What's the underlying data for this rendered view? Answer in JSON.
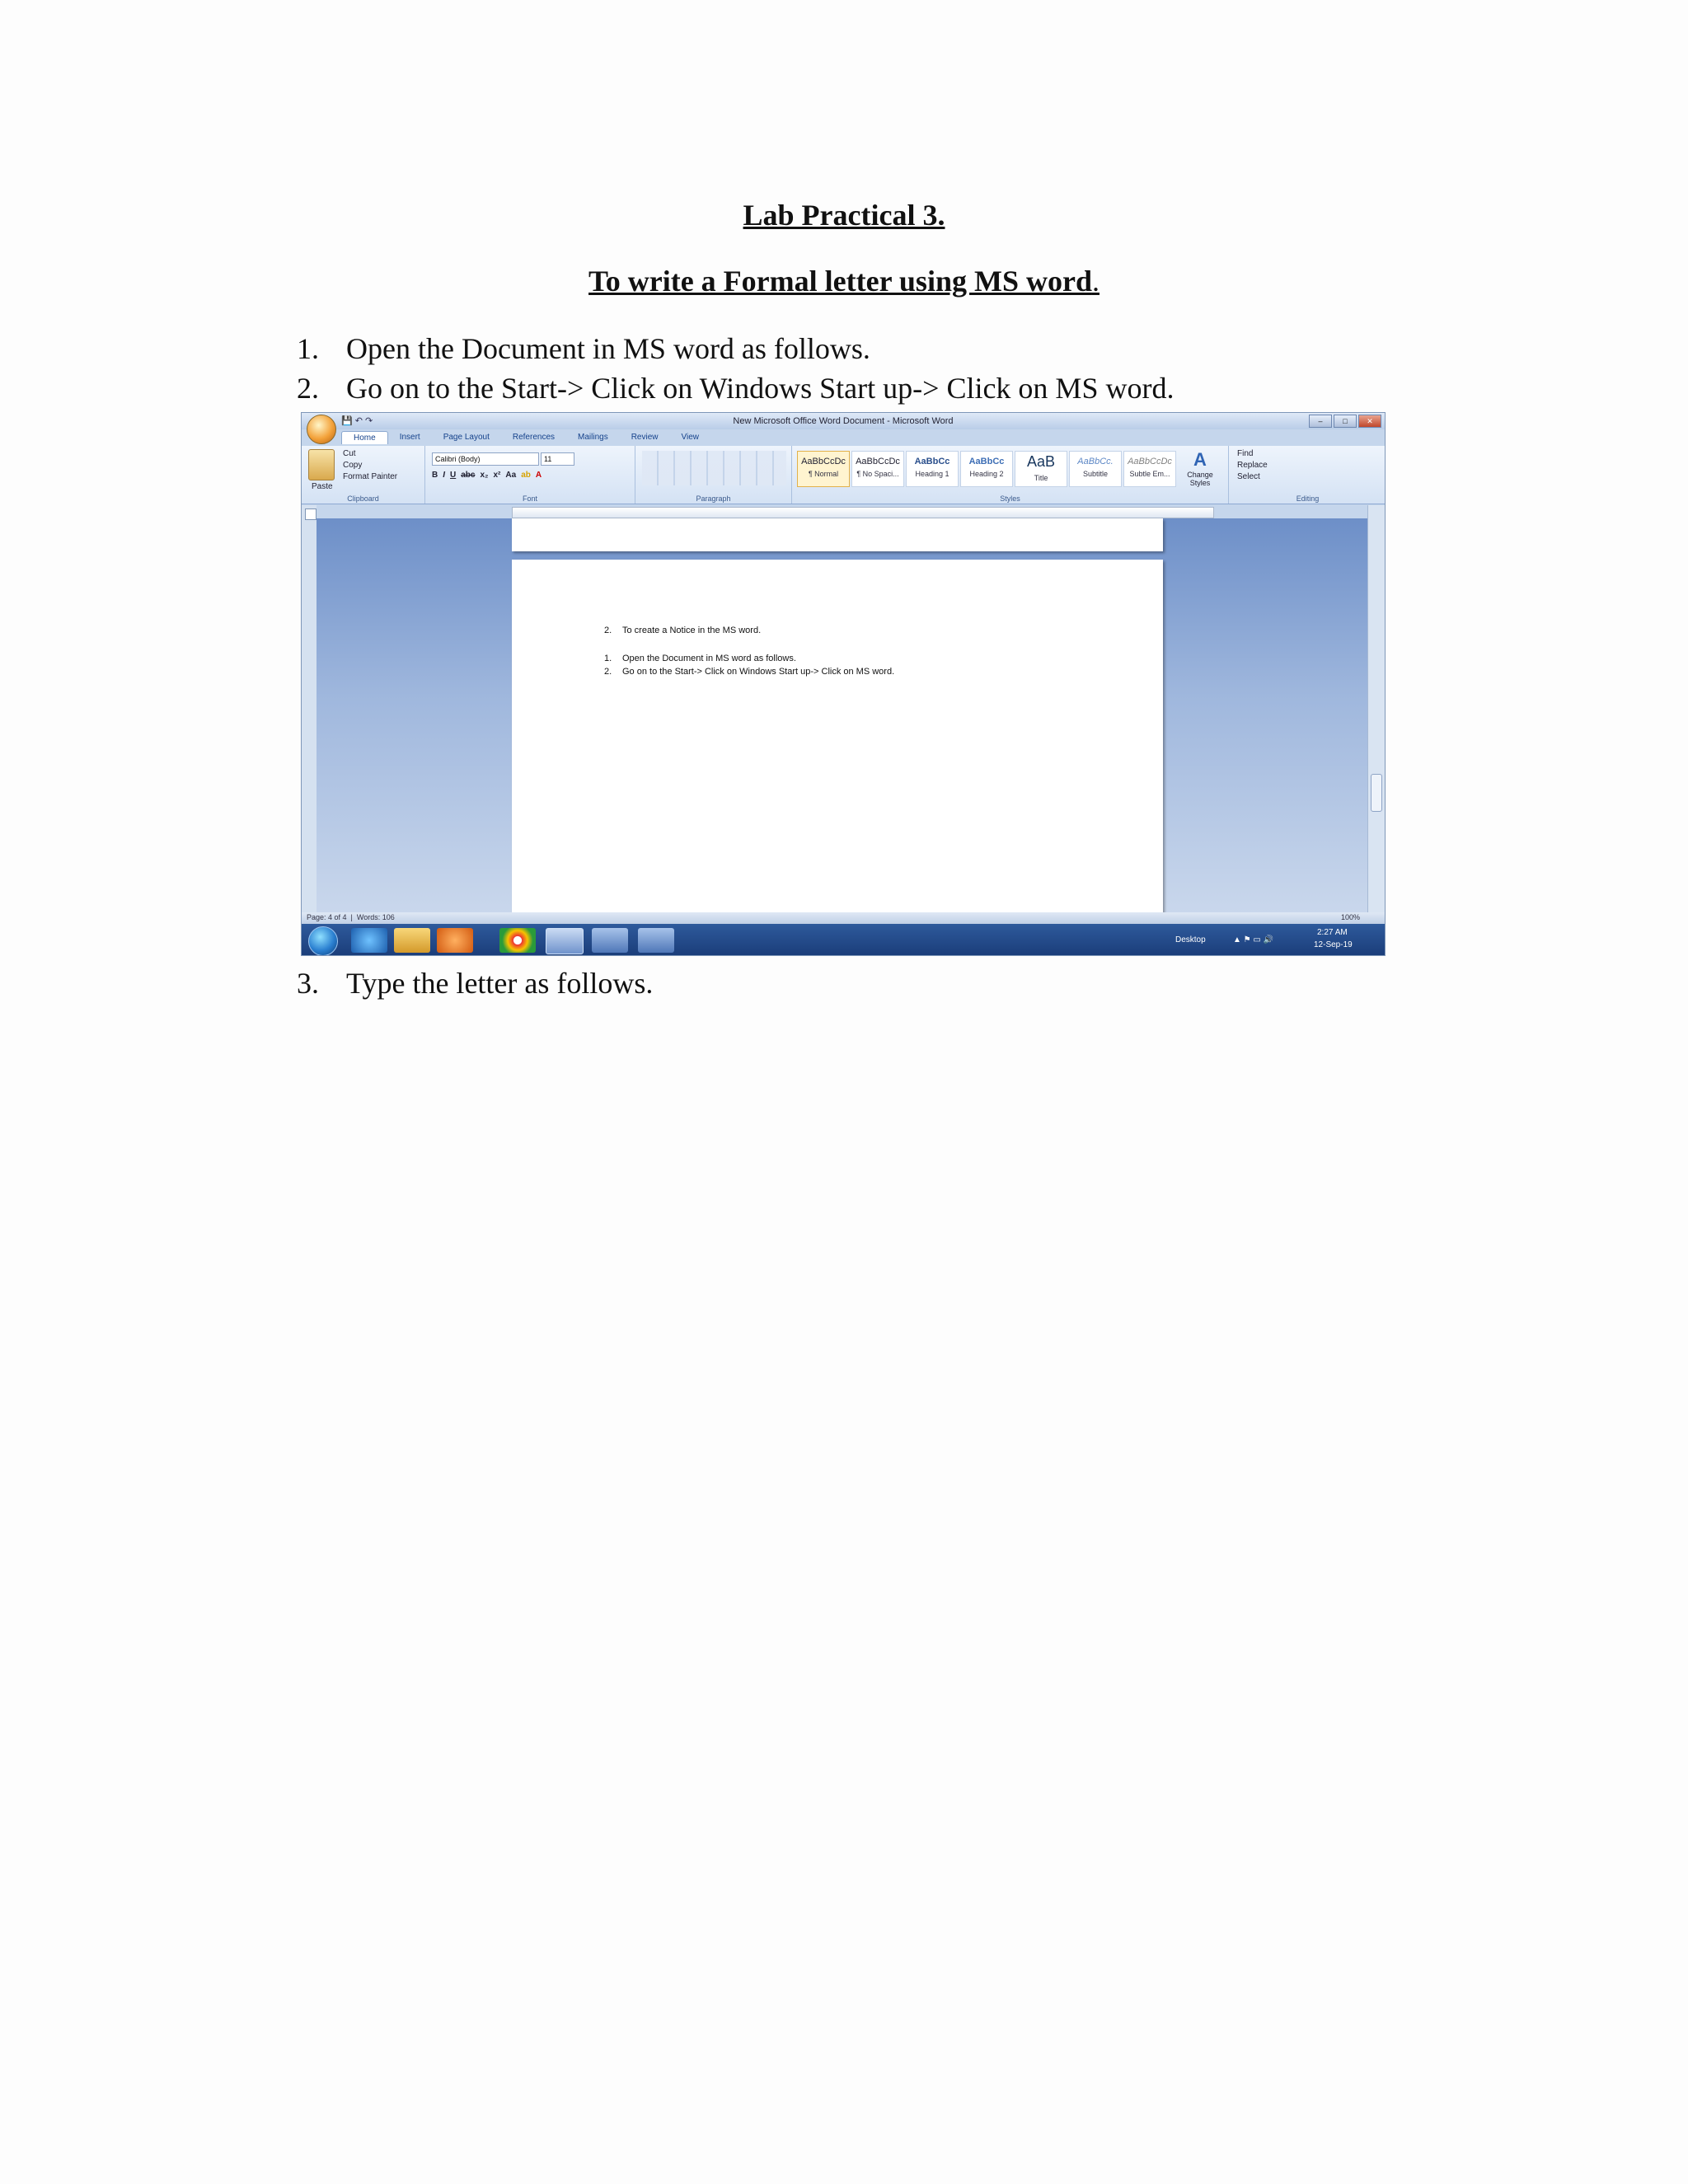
{
  "doc": {
    "title": "Lab Practical 3.",
    "subtitle": "To write a Formal letter using MS word",
    "subtitle_tail": ".",
    "steps": [
      {
        "num": "1.",
        "text": "Open the Document in MS word as follows."
      },
      {
        "num": "2.",
        "text": "Go on to the Start-> Click on Windows Start up-> Click on MS word."
      },
      {
        "num": "3.",
        "text": "Type the letter as follows."
      }
    ]
  },
  "screenshot": {
    "window_title": "New Microsoft Office Word Document - Microsoft Word",
    "tabs": [
      "Home",
      "Insert",
      "Page Layout",
      "References",
      "Mailings",
      "Review",
      "View"
    ],
    "clipboard": {
      "paste": "Paste",
      "cut": "Cut",
      "copy": "Copy",
      "format_painter": "Format Painter",
      "label": "Clipboard"
    },
    "font": {
      "name": "Calibri (Body)",
      "size": "11",
      "label": "Font"
    },
    "paragraph_label": "Paragraph",
    "styles": [
      {
        "sample": "AaBbCcDc",
        "name": "¶ Normal"
      },
      {
        "sample": "AaBbCcDc",
        "name": "¶ No Spaci..."
      },
      {
        "sample": "AaBbCc",
        "name": "Heading 1"
      },
      {
        "sample": "AaBbCc",
        "name": "Heading 2"
      },
      {
        "sample": "AaB",
        "name": "Title"
      },
      {
        "sample": "AaBbCc.",
        "name": "Subtitle"
      },
      {
        "sample": "AaBbCcDc",
        "name": "Subtle Em..."
      }
    ],
    "styles_label": "Styles",
    "change_styles": "Change Styles",
    "editing": {
      "find": "Find",
      "replace": "Replace",
      "select": "Select",
      "label": "Editing"
    },
    "page_lines": [
      {
        "num": "2.",
        "text": "To create a Notice in the MS word."
      },
      {
        "num": "1.",
        "text": "Open the Document in MS word as follows."
      },
      {
        "num": "2.",
        "text": "Go on to the Start-> Click on Windows Start up-> Click on MS word."
      }
    ],
    "status": {
      "page": "Page: 4 of 4",
      "words": "Words: 106",
      "zoom": "100%"
    },
    "taskbar": {
      "desktop": "Desktop",
      "time": "2:27 AM",
      "date": "12-Sep-19"
    }
  }
}
